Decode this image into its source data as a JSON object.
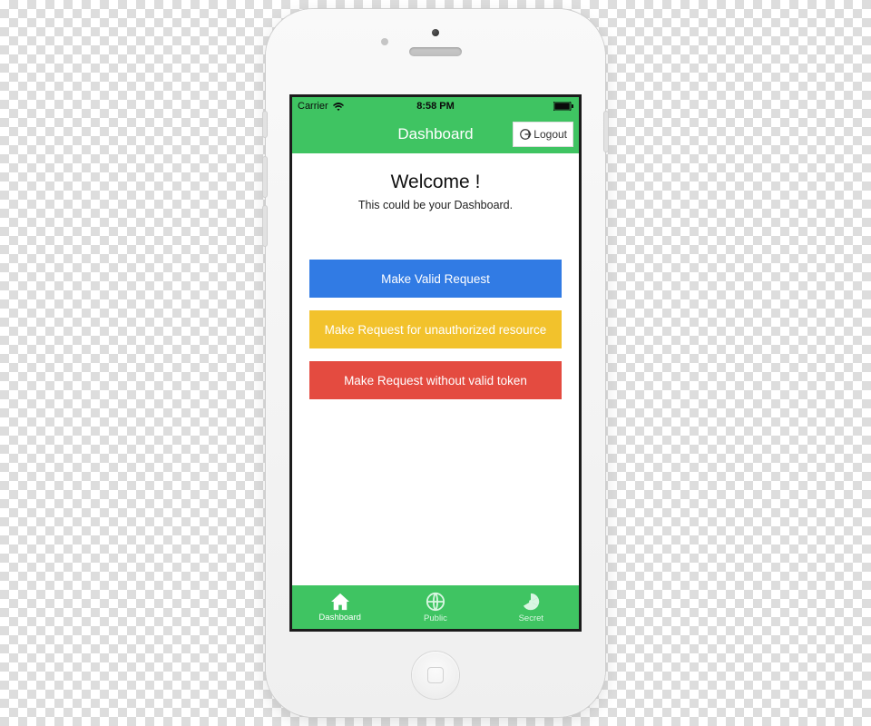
{
  "statusbar": {
    "carrier": "Carrier",
    "time": "8:58 PM"
  },
  "navbar": {
    "title": "Dashboard",
    "logout_label": "Logout"
  },
  "content": {
    "welcome_title": "Welcome !",
    "welcome_subtitle": "This could be your Dashboard.",
    "buttons": {
      "valid": "Make Valid Request",
      "unauthorized": "Make Request for unauthorized resource",
      "notoken": "Make Request without valid token"
    }
  },
  "tabs": {
    "dashboard": "Dashboard",
    "public": "Public",
    "secret": "Secret"
  },
  "colors": {
    "brand_green": "#3fc462",
    "btn_blue": "#317be4",
    "btn_yellow": "#f2c22c",
    "btn_red": "#e44b40"
  }
}
